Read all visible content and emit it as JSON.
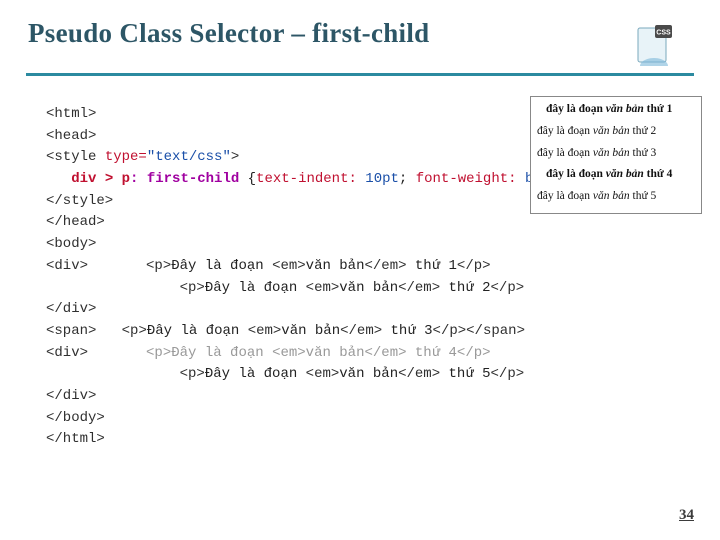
{
  "header": {
    "title": "Pseudo Class Selector – first-child",
    "icon": "css-file-icon"
  },
  "code": {
    "html_open": "<html>",
    "head_open": "<head>",
    "style_open_tag": "<style",
    "style_attr_name": "type=",
    "style_attr_val": "\"text/css\"",
    "style_open_close": ">",
    "selector_part1": "div > p",
    "selector_pseudo": ": first-child",
    "rule_open": "{",
    "prop1": "text-indent:",
    "val1": "10pt",
    "sep1": ";",
    "prop2": "font-weight:",
    "val2": "bold",
    "sep2": ";",
    "rule_close": "}",
    "style_close": "</style>",
    "head_close": "</head>",
    "body_open": "<body>",
    "div_open": "<div>",
    "p_open": "<p>",
    "txt_pre": "Đây là đoạn ",
    "em_open": "<em>",
    "em_txt": "văn bản",
    "em_close": "</em>",
    "txt_suf1": " thứ 1",
    "txt_suf2": " thứ 2",
    "txt_suf3": " thứ 3",
    "txt_suf4": " thứ 4",
    "txt_suf5": " thứ 5",
    "p_close": "</p>",
    "div_close": "</div>",
    "span_open": "<span>",
    "span_close": "</span>",
    "body_close": "</body>",
    "html_close": "</html>"
  },
  "output": {
    "l1_pre": "đây là đoạn ",
    "l1_em": "văn bản",
    "l1_suf": " thứ 1",
    "l2_pre": "đây là đoạn ",
    "l2_em": "văn bản",
    "l2_suf": " thứ 2",
    "l3_pre": "đây là đoạn ",
    "l3_em": "văn bản",
    "l3_suf": " thứ 3",
    "l4_pre": "đây là đoạn ",
    "l4_em": "văn bản",
    "l4_suf": " thứ 4",
    "l5_pre": "đây là đoạn ",
    "l5_em": "văn bản",
    "l5_suf": " thứ 5"
  },
  "footer": {
    "page": "34"
  }
}
